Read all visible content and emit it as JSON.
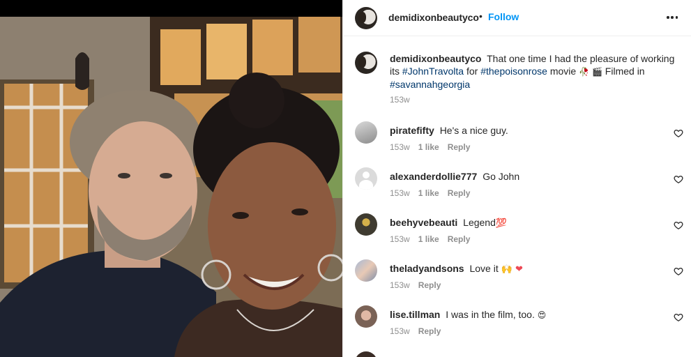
{
  "post": {
    "owner_username": "demidixonbeautyco",
    "separator": "•",
    "follow_label": "Follow",
    "more_icon": "more-horizontal-icon"
  },
  "caption": {
    "username": "demidixonbeautyco",
    "text_1": "That one time I had the pleasure of working its",
    "hashtag_1": "#JohnTravolta",
    "text_2": "for",
    "hashtag_2": "#thepoisonrose",
    "text_3": "movie",
    "emoji_1": "🥀",
    "emoji_2": "🎬",
    "text_4": "Filmed in",
    "hashtag_3": "#savannahgeorgia",
    "time": "153w"
  },
  "comments": [
    {
      "username": "piratefifty",
      "text": "He's a nice guy.",
      "emoji": "",
      "time": "153w",
      "likes": "1 like",
      "reply": "Reply"
    },
    {
      "username": "alexanderdollie777",
      "text": "Go John",
      "emoji": "",
      "time": "153w",
      "likes": "1 like",
      "reply": "Reply"
    },
    {
      "username": "beehyvebeauti",
      "text": "Legend",
      "emoji": "💯",
      "time": "153w",
      "likes": "1 like",
      "reply": "Reply"
    },
    {
      "username": "theladyandsons",
      "text": "Love it",
      "emoji": "🙌 ❤",
      "time": "153w",
      "likes": "",
      "reply": "Reply"
    },
    {
      "username": "lise.tillman",
      "text": "I was in the film, too.",
      "emoji": "😍",
      "time": "153w",
      "likes": "",
      "reply": "Reply"
    }
  ],
  "colors": {
    "link": "#0095f6",
    "hashtag": "#00376b",
    "muted": "#8e8e8e",
    "text": "#262626",
    "heart_red": "#ed4956"
  }
}
